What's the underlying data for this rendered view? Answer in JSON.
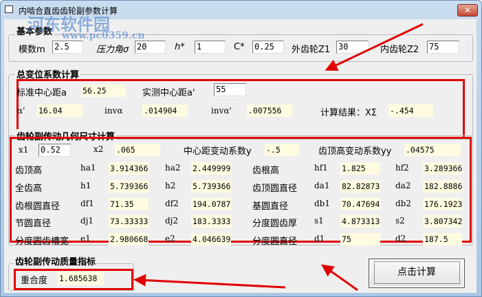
{
  "window": {
    "title": "内啮合直齿齿轮副参数计算",
    "close": "✕"
  },
  "watermark": {
    "name": "河东软件园",
    "url": "www.pc0359.cn"
  },
  "basic": {
    "title": "基本参数",
    "fields": [
      {
        "label": "模数m",
        "value": "2.5"
      },
      {
        "label": "压力角σ",
        "value": "20"
      },
      {
        "label": "h*",
        "value": "1"
      },
      {
        "label": "C*",
        "value": "0.25"
      },
      {
        "label": "外齿轮Z1",
        "value": "30"
      },
      {
        "label": "内齿轮Z2",
        "value": "75"
      }
    ]
  },
  "shift": {
    "title": "总变位系数计算",
    "std_label": "标准中心距a",
    "std_value": "56.25",
    "meas_label": "实测中心距a'",
    "meas_value": "55",
    "alpha_label": "α'",
    "alpha_value": "16.04",
    "inv_label": "invα",
    "inv_value": ".014904",
    "invp_label": "invα'",
    "invp_value": ".007556",
    "result_label": "计算结果：XΣ",
    "result_value": "-.454"
  },
  "geom": {
    "title": "齿轮副传动几何尺寸计算",
    "x1_label": "x1",
    "x1_value": "0.52",
    "x2_label": "x2",
    "x2_value": ".065",
    "y_label": "中心距变动系数y",
    "y_value": "-.5",
    "yy_label": "齿顶高变动系数yy",
    "yy_value": ".04575",
    "rows": [
      {
        "l1": "齿顶高",
        "s1": "ha1",
        "v1": "3.914366",
        "s2": "ha2",
        "v2": "2.449999",
        "l2": "齿根高",
        "s3": "hf1",
        "v3": "1.825",
        "s4": "hf2",
        "v4": "3.289366"
      },
      {
        "l1": "全齿高",
        "s1": "h1",
        "v1": "5.739366",
        "s2": "h2",
        "v2": "5.739366",
        "l2": "齿顶圆直径",
        "s3": "da1",
        "v3": "82.82873",
        "s4": "da2",
        "v4": "182.8886"
      },
      {
        "l1": "齿根圆直径",
        "s1": "df1",
        "v1": "71.35",
        "s2": "df2",
        "v2": "194.0787",
        "l2": "基圆直径",
        "s3": "db1",
        "v3": "70.47694",
        "s4": "db2",
        "v4": "176.1923"
      },
      {
        "l1": "节圆直径",
        "s1": "dj1",
        "v1": "73.33333",
        "s2": "dj2",
        "v2": "183.3333",
        "l2": "分度圆齿厚",
        "s3": "s1",
        "v3": "4.873313",
        "s4": "s2",
        "v4": "3.807342"
      },
      {
        "l1": "分度圆齿槽宽",
        "s1": "e1",
        "v1": "2.980668",
        "s2": "e2",
        "v2": "4.046639",
        "l2": "分度圆直径",
        "s3": "d1",
        "v3": "75",
        "s4": "d2",
        "v4": "187.5"
      }
    ]
  },
  "quality": {
    "title": "齿轮副传动质量指标",
    "label": "重合度",
    "value": "1.685638"
  },
  "button": {
    "label": "点击计算"
  },
  "colors": {
    "highlight": "#e00000",
    "readonly_bg": "#fffbe0"
  }
}
